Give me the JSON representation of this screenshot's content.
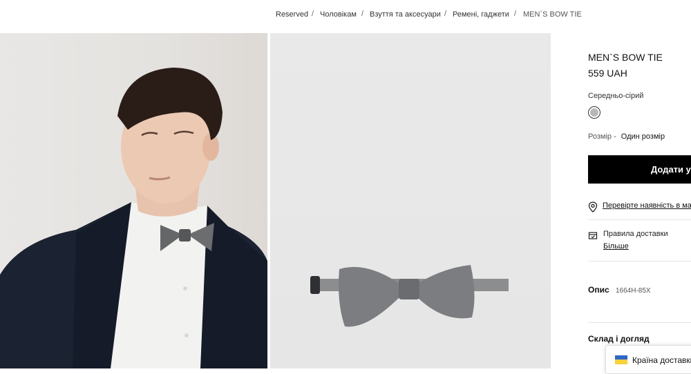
{
  "breadcrumb": {
    "items": [
      "Reserved",
      "Чоловікам",
      "Взуття та аксесуари",
      "Ремені, гаджети",
      "MEN`S BOW TIE"
    ],
    "separator": "/"
  },
  "gallery": {
    "images": [
      {
        "name": "model-wearing-bow-tie-photo"
      },
      {
        "name": "bow-tie-product-photo"
      }
    ]
  },
  "product": {
    "title": "MEN`S BOW TIE",
    "price": "559 UAH",
    "color": {
      "name": "Середньо-сірий",
      "swatch": "#b8b8b8"
    },
    "size": {
      "label": "Розмір -",
      "value": "Один розмір"
    },
    "add_to_cart_label": "Додати у кошик",
    "store_check_label": "Перевірте наявність в магазинах",
    "delivery": {
      "title": "Правила доставки",
      "more": "Більше"
    },
    "description": {
      "label": "Опис",
      "code": "1664H-85X"
    },
    "composition_title": "Склад і догляд"
  },
  "country_selector": {
    "label": "Країна доставки"
  },
  "colors": {
    "button_bg": "#000000",
    "button_text": "#ffffff",
    "flag_blue": "#2f67c9",
    "flag_yellow": "#f6d23c"
  }
}
